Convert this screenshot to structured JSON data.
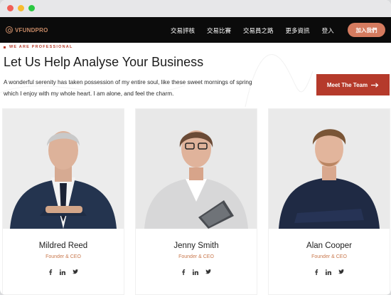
{
  "nav": {
    "logo_text": "VFUNDPRO",
    "items": [
      {
        "label": "交易評核"
      },
      {
        "label": "交易比賽"
      },
      {
        "label": "交易員之路"
      },
      {
        "label": "更多資訊"
      },
      {
        "label": "登入"
      }
    ],
    "cta_label": "加入我們"
  },
  "hero": {
    "eyebrow": "WE ARE PROFESSIONAL",
    "title": "Let Us Help Analyse Your Business",
    "intro": "A wonderful serenity has taken possession of my entire soul, like these sweet mornings of spring which I enjoy with my whole heart. I am alone, and feel the charm.",
    "button_label": "Meet The Team",
    "button_icon": "arrow-right-icon"
  },
  "team": [
    {
      "name": "Mildred Reed",
      "role": "Founder & CEO",
      "social": [
        "facebook-icon",
        "linkedin-icon",
        "twitter-icon"
      ]
    },
    {
      "name": "Jenny Smith",
      "role": "Founder & CEO",
      "social": [
        "facebook-icon",
        "linkedin-icon",
        "twitter-icon"
      ]
    },
    {
      "name": "Alan Cooper",
      "role": "Founder & CEO",
      "social": [
        "facebook-icon",
        "linkedin-icon",
        "twitter-icon"
      ]
    }
  ],
  "colors": {
    "accent": "#b53a2b",
    "cta": "#d57b5f",
    "role_text": "#c9794f",
    "navbar": "#0b0b0b"
  }
}
